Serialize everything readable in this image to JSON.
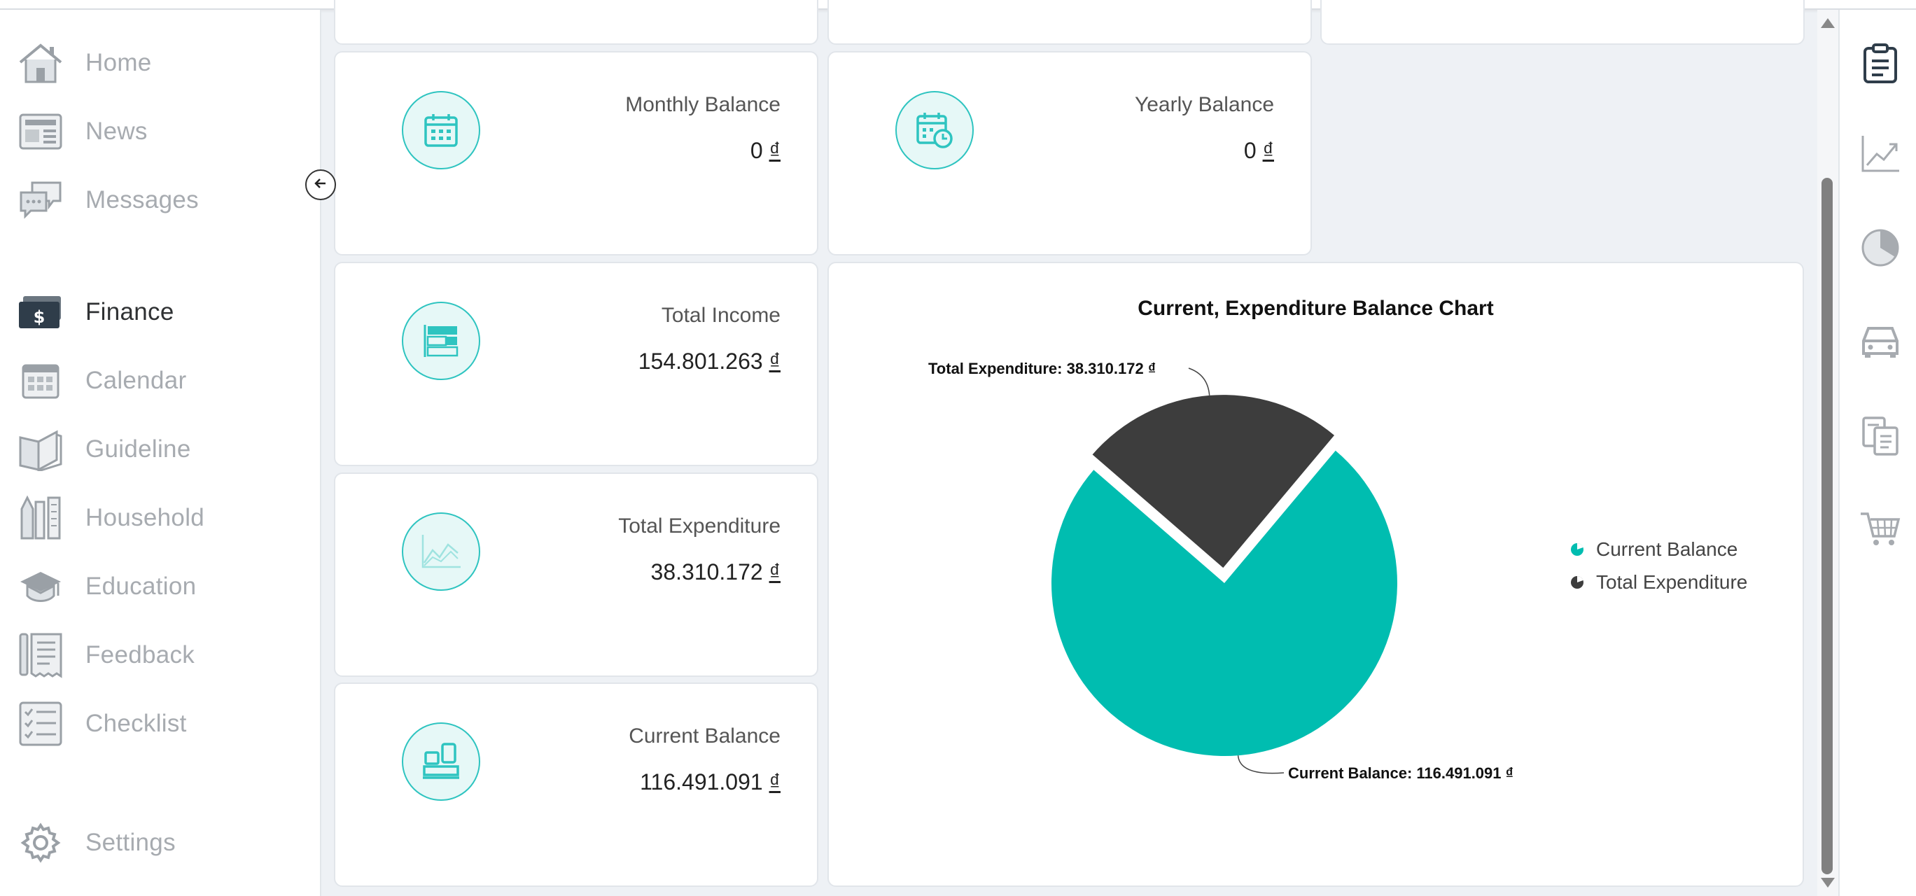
{
  "sidebar": {
    "items": [
      {
        "label": "Home",
        "icon": "home-icon"
      },
      {
        "label": "News",
        "icon": "news-icon"
      },
      {
        "label": "Messages",
        "icon": "messages-icon"
      },
      {
        "label": "Finance",
        "icon": "finance-icon",
        "active": true
      },
      {
        "label": "Calendar",
        "icon": "calendar-icon"
      },
      {
        "label": "Guideline",
        "icon": "guideline-icon"
      },
      {
        "label": "Household",
        "icon": "household-icon"
      },
      {
        "label": "Education",
        "icon": "education-icon"
      },
      {
        "label": "Feedback",
        "icon": "feedback-icon"
      },
      {
        "label": "Checklist",
        "icon": "checklist-icon"
      }
    ],
    "settings": {
      "label": "Settings",
      "icon": "gear-icon"
    }
  },
  "cards": {
    "monthly": {
      "title": "Monthly Balance",
      "value": "0",
      "currency": "₫"
    },
    "yearly": {
      "title": "Yearly Balance",
      "value": "0",
      "currency": "₫"
    },
    "income": {
      "title": "Total Income",
      "value": "154.801.263",
      "currency": "₫"
    },
    "expenditure": {
      "title": "Total Expenditure",
      "value": "38.310.172",
      "currency": "₫"
    },
    "balance": {
      "title": "Current Balance",
      "value": "116.491.091",
      "currency": "₫"
    }
  },
  "colors": {
    "accent": "#00bdb0",
    "dark": "#3d3d3d",
    "icon_teal": "#2ec4c0",
    "muted": "#a7abb0"
  },
  "chart_data": {
    "type": "pie",
    "title": "Current, Expenditure Balance Chart",
    "slices": [
      {
        "name": "Current Balance",
        "value": 116491091,
        "color": "#00bdb0",
        "label": "Current Balance: 116.491.091 ₫"
      },
      {
        "name": "Total Expenditure",
        "value": 38310172,
        "color": "#3d3d3d",
        "label": "Total Expenditure: 38.310.172 ₫"
      }
    ],
    "legend": [
      "Current Balance",
      "Total Expenditure"
    ],
    "legend_position": "right"
  },
  "right_toolbar": [
    "clipboard-icon",
    "trend-chart-icon",
    "pie-chart-icon",
    "car-icon",
    "documents-icon",
    "cart-icon"
  ]
}
